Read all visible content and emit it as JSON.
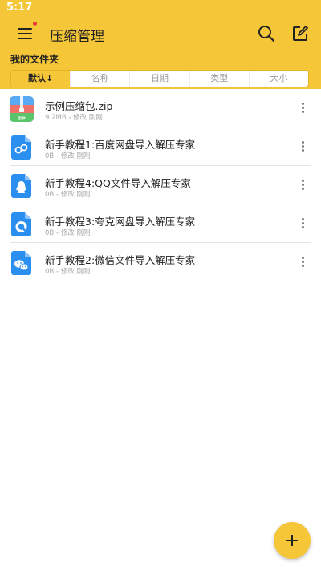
{
  "status_bar": {
    "time": "5:17"
  },
  "app_bar": {
    "title": "压缩管理"
  },
  "folder": {
    "title": "我的文件夹"
  },
  "sort_tabs": [
    {
      "label": "默认↓",
      "active": true
    },
    {
      "label": "名称",
      "active": false
    },
    {
      "label": "日期",
      "active": false
    },
    {
      "label": "类型",
      "active": false
    },
    {
      "label": "大小",
      "active": false
    }
  ],
  "files": [
    {
      "name": "示例压缩包.zip",
      "meta": "9.2MB - 修改 刚刚",
      "icon": "zip-icon"
    },
    {
      "name": "新手教程1:百度网盘导入解压专家",
      "meta": "0B - 修改 刚刚",
      "icon": "baidu-netdisk-icon"
    },
    {
      "name": "新手教程4:QQ文件导入解压专家",
      "meta": "0B - 修改 刚刚",
      "icon": "qq-icon"
    },
    {
      "name": "新手教程3:夸克网盘导入解压专家",
      "meta": "0B - 修改 刚刚",
      "icon": "quark-icon"
    },
    {
      "name": "新手教程2:微信文件导入解压专家",
      "meta": "0B - 修改 刚刚",
      "icon": "wechat-icon"
    }
  ],
  "colors": {
    "accent": "#f5c638",
    "notification_dot": "#e53935",
    "file_doc_blue": "#2b8ff0"
  }
}
